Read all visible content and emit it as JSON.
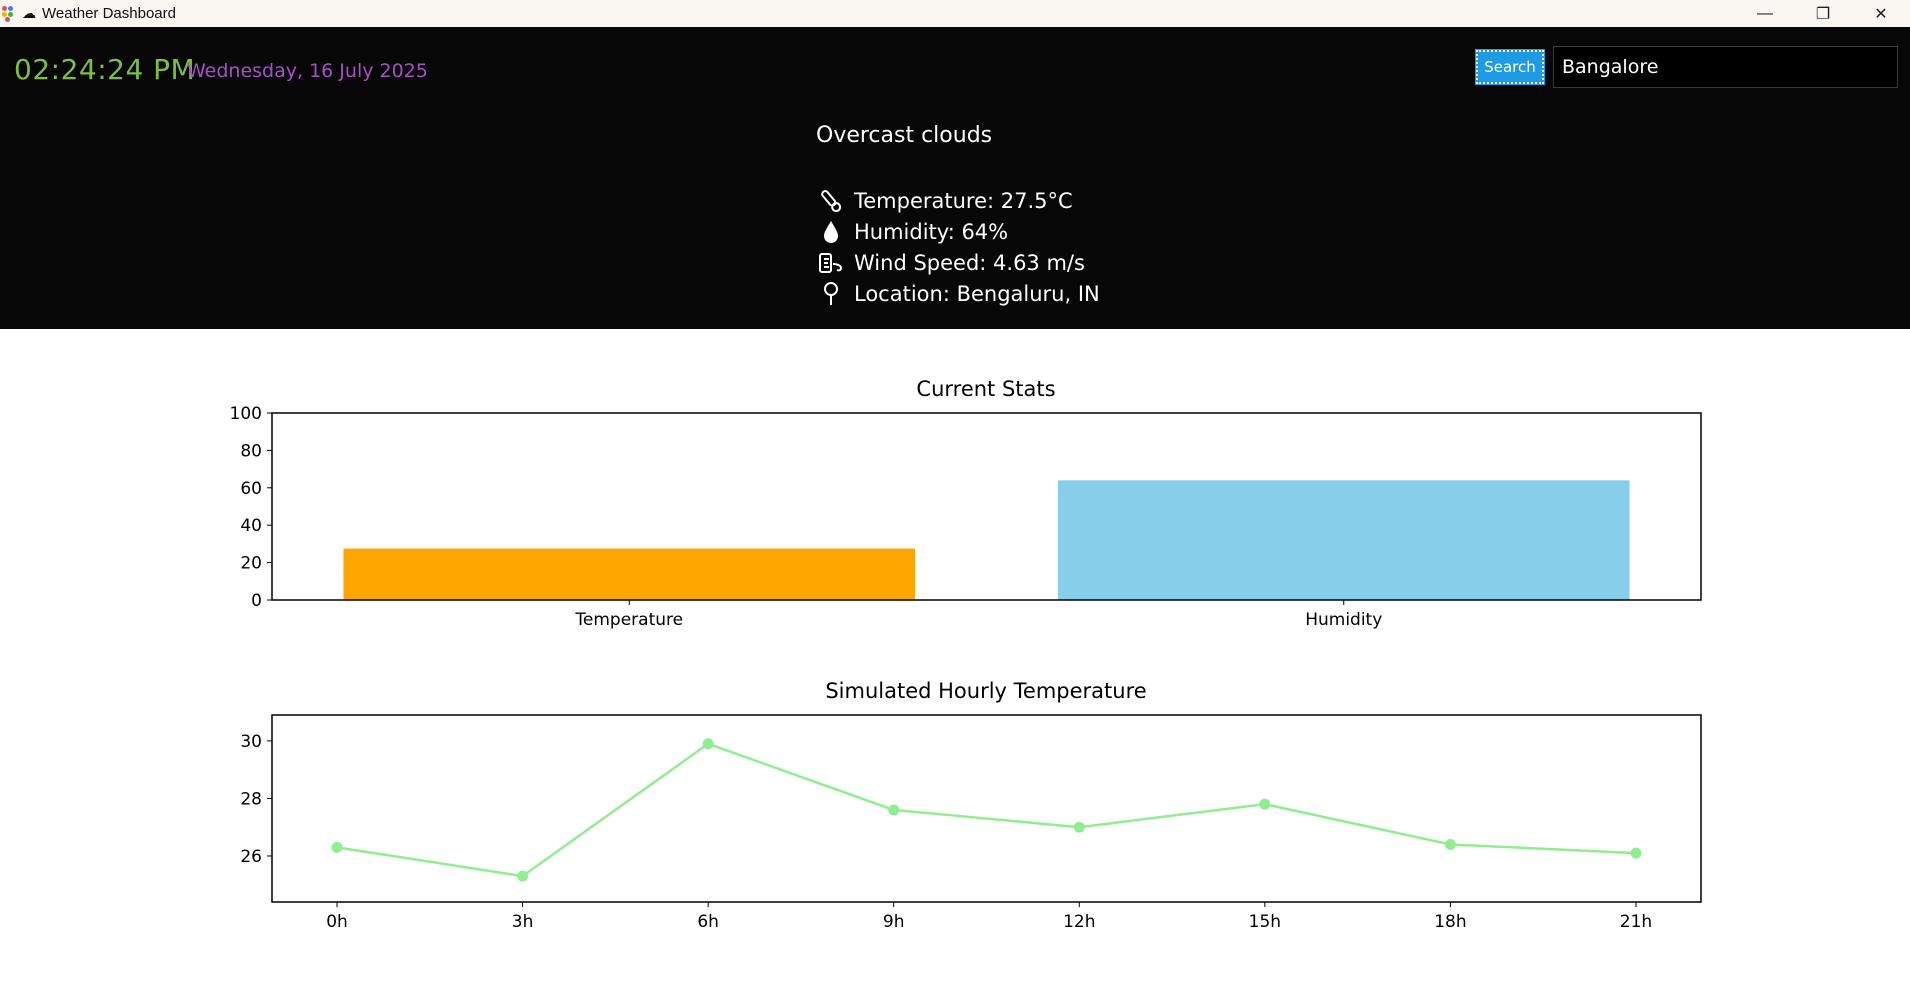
{
  "window": {
    "title": "Weather Dashboard",
    "minimize_glyph": "—",
    "restore_glyph": "❐",
    "close_glyph": "✕"
  },
  "header": {
    "time": "02:24:24 PM",
    "date": "Wednesday, 16 July 2025",
    "search_label": "Search",
    "search_value": "Bangalore",
    "condition": "Overcast clouds",
    "stats": {
      "temperature": "Temperature: 27.5°C",
      "humidity": "Humidity: 64%",
      "wind": "Wind Speed: 4.63 m/s",
      "location": "Location: Bengaluru, IN"
    },
    "icons": [
      "thermometer-icon",
      "droplet-icon",
      "wind-icon",
      "location-pin-icon"
    ]
  },
  "colors": {
    "clock": "#7fbf3f",
    "date": "#a64fc8",
    "search_button": "#1f9be3",
    "temperature_bar": "#ffa500",
    "humidity_bar": "#87ceeb",
    "hourly_line": "#90ee90"
  },
  "chart_data": [
    {
      "type": "bar",
      "title": "Current Stats",
      "categories": [
        "Temperature",
        "Humidity"
      ],
      "values": [
        27.5,
        64
      ],
      "ylim": [
        0,
        100
      ],
      "yticks": [
        0,
        20,
        40,
        60,
        80,
        100
      ],
      "xlabel": "",
      "ylabel": "",
      "grid": false
    },
    {
      "type": "line",
      "title": "Simulated Hourly Temperature",
      "x": [
        "0h",
        "3h",
        "6h",
        "9h",
        "12h",
        "15h",
        "18h",
        "21h"
      ],
      "values": [
        26.3,
        25.3,
        29.9,
        27.6,
        27.0,
        27.8,
        26.4,
        26.1
      ],
      "ylim": [
        24.4,
        30.9
      ],
      "yticks": [
        26,
        28,
        30
      ],
      "xlabel": "",
      "ylabel": "",
      "grid": false,
      "markers": true
    }
  ]
}
